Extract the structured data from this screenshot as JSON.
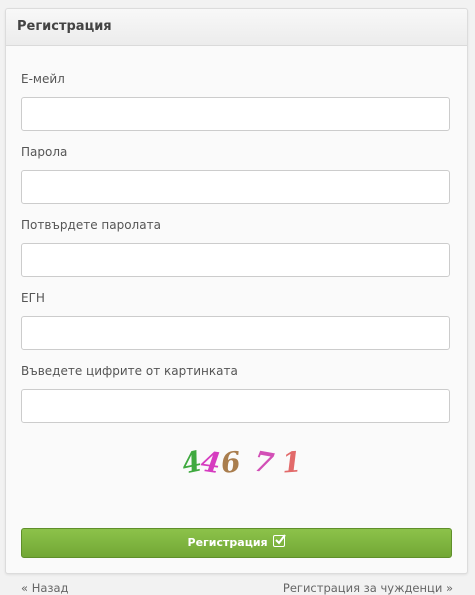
{
  "header": {
    "title": "Регистрация"
  },
  "form": {
    "email_label": "Е-мейл",
    "password_label": "Парола",
    "confirm_label": "Потвърдете паролата",
    "egn_label": "ЕГН",
    "captcha_label": "Въведете цифрите от картинката",
    "email_value": "",
    "password_value": "",
    "confirm_value": "",
    "egn_value": "",
    "captcha_value": ""
  },
  "captcha": {
    "digits": [
      "4",
      "4",
      "6",
      "7",
      "1"
    ],
    "colors": [
      "#3fa93f",
      "#d63cc0",
      "#a97d4d",
      "#d24fb6",
      "#e26a6a"
    ]
  },
  "actions": {
    "submit_label": "Регистрация",
    "back_label": "« Назад",
    "foreigners_label": "Регистрация за чужденци »"
  }
}
